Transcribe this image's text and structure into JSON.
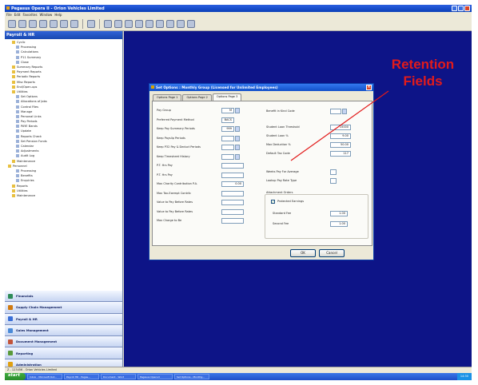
{
  "window": {
    "title": "Pegasus Opera II - Orion Vehicles Limited"
  },
  "menu": [
    "File",
    "Edit",
    "Favorites",
    "Window",
    "Help"
  ],
  "sidebar": {
    "title": "Payroll & HR",
    "tree": [
      {
        "label": "Cyclic",
        "level": 1
      },
      {
        "label": "Processing",
        "level": 2
      },
      {
        "label": "Calculations",
        "level": 2
      },
      {
        "label": "P11 Summary",
        "level": 2
      },
      {
        "label": "Close",
        "level": 2
      },
      {
        "label": "Summary Reports",
        "level": 1
      },
      {
        "label": "Payment Reports",
        "level": 1
      },
      {
        "label": "Periodic Reports",
        "level": 1
      },
      {
        "label": "Misc Reports",
        "level": 1
      },
      {
        "label": "End/Open-ups",
        "level": 1
      },
      {
        "label": "Utilities",
        "level": 1
      },
      {
        "label": "Set Options",
        "level": 2
      },
      {
        "label": "Allocations of Jobs",
        "level": 2
      },
      {
        "label": "Control Files",
        "level": 2
      },
      {
        "label": "Manage",
        "level": 2
      },
      {
        "label": "Personal Links",
        "level": 2
      },
      {
        "label": "Pay Periods",
        "level": 2
      },
      {
        "label": "PAYE Bands",
        "level": 2
      },
      {
        "label": "Update",
        "level": 2
      },
      {
        "label": "Reports Check",
        "level": 2
      },
      {
        "label": "Set Pension Funds",
        "level": 2
      },
      {
        "label": "Calendar",
        "level": 2
      },
      {
        "label": "Adjustments",
        "level": 2
      },
      {
        "label": "Audit Log",
        "level": 2
      },
      {
        "label": "Maintenance",
        "level": 1
      },
      {
        "label": "Personnel",
        "level": 0
      },
      {
        "label": "Processing",
        "level": 2
      },
      {
        "label": "Benefits",
        "level": 2
      },
      {
        "label": "Enquiries",
        "level": 2
      },
      {
        "label": "Reports",
        "level": 1
      },
      {
        "label": "Utilities",
        "level": 1
      },
      {
        "label": "Maintenance",
        "level": 1
      }
    ],
    "modules": [
      {
        "label": "Financials",
        "color": "#2e8b57"
      },
      {
        "label": "Supply Chain Management",
        "color": "#d07a10"
      },
      {
        "label": "Payroll & HR",
        "color": "#3a6fd8"
      },
      {
        "label": "Sales Management",
        "color": "#4a8ad8"
      },
      {
        "label": "Document Management",
        "color": "#c2543a"
      },
      {
        "label": "Reporting",
        "color": "#5a9a3a"
      },
      {
        "label": "Administration",
        "color": "#e0a010"
      }
    ],
    "footer": "» ⁑"
  },
  "status": {
    "text": "Z - 123456 - Orion Vehicles Limited"
  },
  "taskbar": {
    "start": "start",
    "tasks": [
      "Inbox - Microsoft Out...",
      "Payroll HR - Pegas...",
      "Document - Word",
      "Pegasus Opera II",
      "Set Options - Monthly..."
    ],
    "clock": "14:30"
  },
  "dialog": {
    "title": "Set Options : Monthly Group (Licensed for Unlimited Employees)",
    "tabs": [
      "Options Page 1",
      "Options Page 2",
      "Options Page 3"
    ],
    "active_tab": 2,
    "left_rows": [
      {
        "label": "Pay Group",
        "value": "M"
      },
      {
        "label": "Preferred Payment Method",
        "value": "BACS"
      },
      {
        "label": "Keep Pay Summary Periods",
        "value": "999"
      },
      {
        "label": "Keep Payslip Periods",
        "value": ""
      },
      {
        "label": "Keep P32 Pay & Deduct Periods",
        "value": ""
      },
      {
        "label": "Keep Timesheet History",
        "value": ""
      },
      {
        "label": "P.T. Hrs Pay",
        "value": ""
      },
      {
        "label": "P.T. Hrs Pay",
        "value": ""
      },
      {
        "label": "Max Charity Contribution P.A.",
        "value": "0.00"
      },
      {
        "label": "Max Tax-Exempt Contrib",
        "value": ""
      },
      {
        "label": "Value to Pay Before Rates",
        "value": ""
      },
      {
        "label": "Value to Pay Before Rates",
        "value": ""
      },
      {
        "label": "Max Charge to Be",
        "value": ""
      }
    ],
    "right_top": [
      {
        "label": "Benefit in Kind Code",
        "value": ""
      },
      {
        "label": "Student Loan Threshold",
        "value": "15000"
      },
      {
        "label": "Student Loan %",
        "value": "9.00"
      },
      {
        "label": "Max Deduction %",
        "value": "50.00"
      },
      {
        "label": "Default Tax Code",
        "value": "117"
      }
    ],
    "right_mid": [
      {
        "label": "Weeks Pay For Average",
        "value": ""
      },
      {
        "label": "Lookup Pay Rate Type",
        "value": ""
      }
    ],
    "attachment": {
      "group_label": "Attachment Orders",
      "checkbox_label": "Protected Earnings",
      "checked": true,
      "rows": [
        {
          "label": "Standard Fee",
          "value": "1.00"
        },
        {
          "label": "Second Fee",
          "value": "1.00"
        }
      ]
    },
    "ok": "OK",
    "cancel": "Cancel"
  },
  "annotation": {
    "line1": "Retention",
    "line2": "Fields"
  }
}
